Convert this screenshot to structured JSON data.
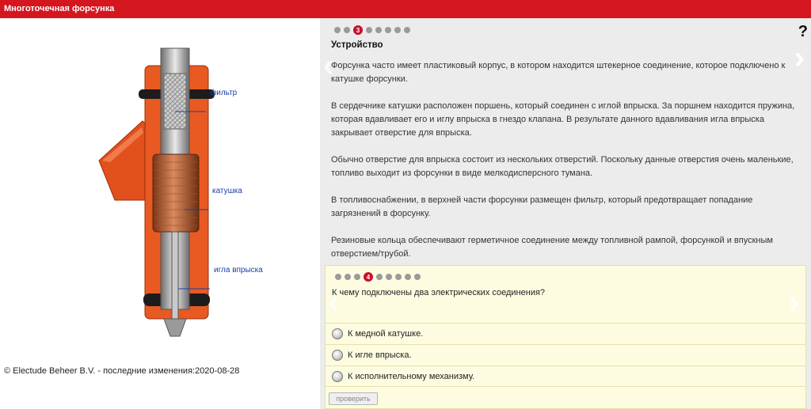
{
  "header": {
    "title": "Многоточечная форсунка"
  },
  "illustration": {
    "callouts": {
      "filter": "фильтр",
      "coil": "катушка",
      "needle": "игла впрыска"
    }
  },
  "footer": {
    "copyright": "© Electude Beheer B.V. - последние изменения:2020-08-28"
  },
  "help": {
    "label": "?"
  },
  "info": {
    "pagination": {
      "total": 8,
      "current": 3,
      "current_label": "3"
    },
    "title": "Устройство",
    "paragraphs": [
      "Форсунка часто имеет пластиковый корпус, в котором находится штекерное соединение, которое подключено к катушке форсунки.",
      "В сердечнике катушки расположен поршень, который соединен с иглой впрыска. За поршнем находится пружина, которая вдавливает его и иглу впрыска в гнездо клапана. В результате данного вдавливания игла впрыска закрывает отверстие для впрыска.",
      "Обычно отверстие для впрыска состоит из нескольких отверстий. Поскольку данные отверстия очень маленькие, топливо выходит из форсунки в виде мелкодисперсного тумана.",
      "В топливоснабжении, в верхней части форсунки размещен фильтр, который предотвращает попадание загрязнений в форсунку.",
      "Резиновые кольца обеспечивают герметичное соединение между топливной рампой, форсункой и впускным отверстием/трубой."
    ]
  },
  "quiz": {
    "pagination": {
      "total": 8,
      "current": 4,
      "current_label": "4"
    },
    "question": "К чему подключены два электрических соединения?",
    "options": [
      "К медной катушке.",
      "К игле впрыска.",
      "К исполнительному механизму."
    ],
    "check_label": "проверить"
  },
  "colors": {
    "brand_red": "#d4161f",
    "panel": "#ececec",
    "quiz_bg": "#fefce0",
    "callout": "#1a3fa6"
  },
  "icons": [
    "chevron-left-icon",
    "chevron-right-icon",
    "help-icon",
    "radio-icon"
  ]
}
